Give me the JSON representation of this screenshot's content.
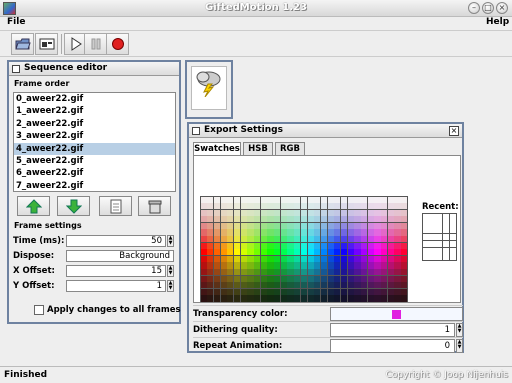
{
  "window": {
    "title": "GiftedMotion 1.23"
  },
  "menu": {
    "file": "File",
    "help": "Help"
  },
  "toolbar": {
    "buttons": [
      {
        "icon": "open-folder-icon"
      },
      {
        "icon": "export-icon"
      },
      {
        "icon": "play-icon"
      },
      {
        "icon": "pause-icon"
      },
      {
        "icon": "record-icon"
      }
    ]
  },
  "sequence_editor": {
    "title": "Sequence editor",
    "frame_order_label": "Frame order",
    "frames": [
      "0_aweer22.gif",
      "1_aweer22.gif",
      "2_aweer22.gif",
      "3_aweer22.gif",
      "4_aweer22.gif",
      "5_aweer22.gif",
      "6_aweer22.gif",
      "7_aweer22.gif"
    ],
    "selected_index": 4,
    "frame_settings_label": "Frame settings",
    "time_label": "Time (ms):",
    "time_value": "50",
    "dispose_label": "Dispose:",
    "dispose_value": "Background",
    "xoffset_label": "X Offset:",
    "xoffset_value": "15",
    "yoffset_label": "Y Offset:",
    "yoffset_value": "1",
    "apply_label": "Apply changes to all frames"
  },
  "export": {
    "title": "Export Settings",
    "tabs": [
      "Swatches",
      "HSB",
      "RGB"
    ],
    "active_tab": "Swatches",
    "recent_label": "Recent:",
    "transparency_label": "Transparency color:",
    "transparency_color": "#e020e0",
    "dithering_label": "Dithering quality:",
    "dithering_value": "1",
    "repeat_label": "Repeat Animation:",
    "repeat_value": "0"
  },
  "status": {
    "text": "Finished",
    "copyright": "Copyright © Joop Nijenhuis"
  },
  "colors": {
    "panel_border": "#6e82a0",
    "selection": "#b8cfe5"
  }
}
